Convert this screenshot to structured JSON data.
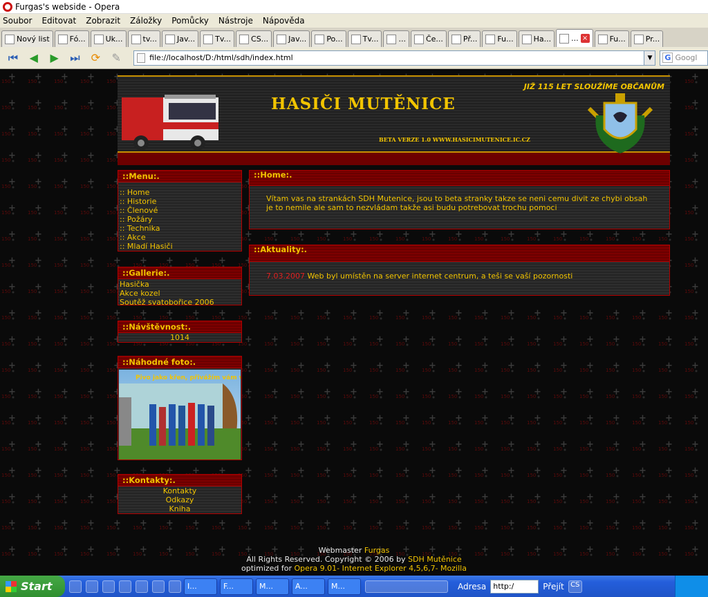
{
  "window": {
    "title": "Furgas's webside - Opera"
  },
  "menu": [
    "Soubor",
    "Editovat",
    "Zobrazit",
    "Záložky",
    "Pomůcky",
    "Nástroje",
    "Nápověda"
  ],
  "tabs": [
    {
      "label": "Nový list",
      "icon": "new-tab-icon"
    },
    {
      "label": "Fó...",
      "icon": "forum-icon"
    },
    {
      "label": "Uk...",
      "icon": "page-icon"
    },
    {
      "label": "tv...",
      "icon": "google-icon"
    },
    {
      "label": "Jav...",
      "icon": "page-icon"
    },
    {
      "label": "Tv...",
      "icon": "at-icon"
    },
    {
      "label": "CS...",
      "icon": "radiation-icon"
    },
    {
      "label": "Jav...",
      "icon": "page-icon"
    },
    {
      "label": "Po...",
      "icon": "globe-icon"
    },
    {
      "label": "Tv...",
      "icon": "opera-icon"
    },
    {
      "label": "...",
      "icon": "firefox-icon"
    },
    {
      "label": "Če...",
      "icon": "page-icon"
    },
    {
      "label": "Př...",
      "icon": "pen-icon"
    },
    {
      "label": "Fu...",
      "icon": "page-icon"
    },
    {
      "label": "Ha...",
      "icon": "star-icon"
    },
    {
      "label": "...",
      "icon": "page-icon",
      "active": true
    },
    {
      "label": "Fu...",
      "icon": "page-icon"
    },
    {
      "label": "Pr...",
      "icon": "page-icon"
    }
  ],
  "address": {
    "url": "file://localhost/D:/html/sdh/index.html",
    "search_placeholder": "Googl"
  },
  "banner": {
    "title": "HASIČI MUTĚNICE",
    "motto": "JIŽ 115 LET SLOUŽÍME   OBČANŮM",
    "beta": "BETA VERZE 1.0 WWW.HASICIMUTENICE.IC.CZ"
  },
  "sidebar": {
    "menu": {
      "title": "::Menu:.",
      "items": [
        ":: Home",
        ":: Historie",
        ":: Členové",
        ":: Požáry",
        ":: Technika",
        ":: Akce",
        ":: Mladí Hasiči"
      ]
    },
    "gallery": {
      "title": "::Gallerie:.",
      "items": [
        "Hasička",
        "Akce kozel",
        "Soutěž svatobořice 2006"
      ]
    },
    "visits": {
      "title": "::Návštěvnost:.",
      "count": "1014"
    },
    "photo": {
      "title": "::Náhodné foto:.",
      "caption": "Pivo jako křen, přivážím vám všem."
    },
    "contacts": {
      "title": "::Kontakty:.",
      "items": [
        "Kontakty",
        "Odkazy",
        "Kniha"
      ]
    }
  },
  "main": {
    "home": {
      "title": "::Home:.",
      "text": "Vítam vas na strankách SDH Mutenice, jsou to beta stranky takze se neni cemu divit ze chybi obsah je to nemile ale sam to nezvládam takže asi budu potrebovat trochu pomoci"
    },
    "news": {
      "title": "::Aktuality:.",
      "date": "7.03.2007",
      "text": "Web byl umístěn na server internet centrum, a teši se vaší pozornosti"
    }
  },
  "footer": {
    "line1_a": "Webmaster ",
    "line1_b": "Furgas",
    "line2_a": "All Rights Reserved. Copyright © 2006 by ",
    "line2_b": "SDH Mutěnice",
    "line3_a": "optimized for ",
    "line3_b": "Opera 9.01- Internet Explorer 4,5,6,7- Mozilla"
  },
  "taskbar": {
    "start": "Start",
    "buttons": [
      "I...",
      "F...",
      "M...",
      "A...",
      "M..."
    ],
    "address_label": "Adresa",
    "address_value": "http:/",
    "go_label": "Přejít",
    "lang": "CS"
  },
  "colors": {
    "accent": "#f2c400",
    "dark_red": "#6d0000",
    "border_red": "#b30000",
    "date_red": "#e02020"
  }
}
